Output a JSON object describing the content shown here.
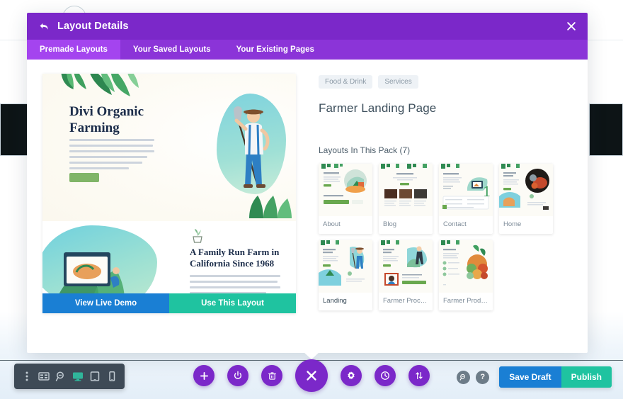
{
  "background": {
    "description": "divi visual builder page behind modal"
  },
  "modal": {
    "title": "Layout Details",
    "back_icon": "back-arrow-icon",
    "close_icon": "close-icon",
    "tabs": [
      {
        "label": "Premade Layouts",
        "active": true
      },
      {
        "label": "Your Saved Layouts",
        "active": false
      },
      {
        "label": "Your Existing Pages",
        "active": false
      }
    ]
  },
  "preview": {
    "hero_heading": "Divi Organic Farming",
    "hero_button": "",
    "section2_heading": "A Family Run Farm in California Since 1968",
    "actions": {
      "demo_label": "View Live Demo",
      "use_label": "Use This Layout"
    }
  },
  "details": {
    "tags": [
      "Food & Drink",
      "Services"
    ],
    "pack_title": "Farmer Landing Page",
    "pack_subtitle": "Layouts In This Pack (7)",
    "layouts": [
      {
        "label": "About",
        "current": false,
        "art": "about"
      },
      {
        "label": "Blog",
        "current": false,
        "art": "blog"
      },
      {
        "label": "Contact",
        "current": false,
        "art": "contact"
      },
      {
        "label": "Home",
        "current": false,
        "art": "home"
      },
      {
        "label": "Landing",
        "current": true,
        "art": "landing"
      },
      {
        "label": "Farmer Proce…",
        "current": false,
        "art": "process"
      },
      {
        "label": "Farmer Prod…",
        "current": false,
        "art": "products"
      }
    ]
  },
  "left_toolbar": {
    "items": [
      {
        "name": "more-options-icon",
        "icon": "dots-vertical"
      },
      {
        "name": "wireframe-view-icon",
        "icon": "wireframe"
      },
      {
        "name": "zoom-view-icon",
        "icon": "magnifier"
      },
      {
        "name": "desktop-view-icon",
        "icon": "desktop",
        "active": true
      },
      {
        "name": "tablet-view-icon",
        "icon": "tablet"
      },
      {
        "name": "phone-view-icon",
        "icon": "phone"
      }
    ]
  },
  "center_toolbar": {
    "items": [
      {
        "name": "add-section-button",
        "icon": "plus"
      },
      {
        "name": "toggle-builder-button",
        "icon": "power"
      },
      {
        "name": "delete-button",
        "icon": "trash"
      },
      {
        "name": "close-menu-button",
        "icon": "close",
        "big": true
      },
      {
        "name": "settings-button",
        "icon": "gear"
      },
      {
        "name": "history-button",
        "icon": "clock"
      },
      {
        "name": "portability-button",
        "icon": "arrows-updown"
      }
    ]
  },
  "right_toolbar": {
    "search_icon": "search-icon",
    "help_icon": "help-icon",
    "save_draft_label": "Save Draft",
    "publish_label": "Publish"
  },
  "colors": {
    "purple": "#7b28c9",
    "purple_light": "#8b34d8",
    "purple_active": "#a444ef",
    "blue": "#1a7fd4",
    "teal": "#1fc3a0",
    "toolbar_dark": "#3e4a56"
  }
}
